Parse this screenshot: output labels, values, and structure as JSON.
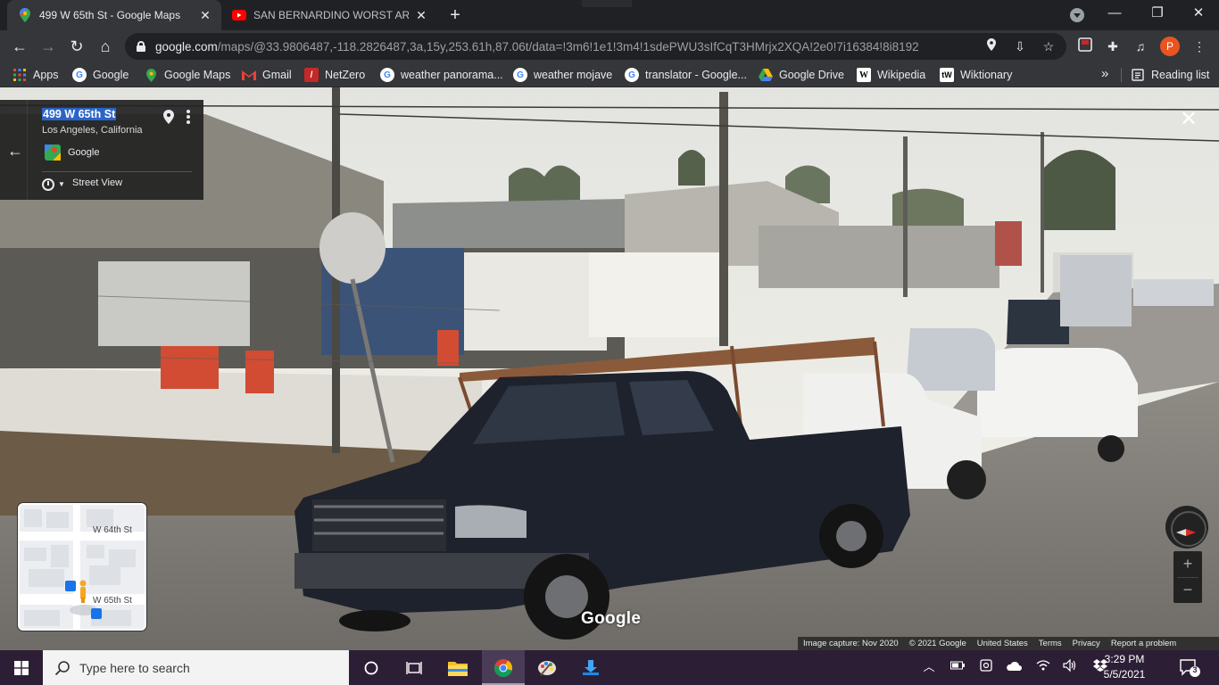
{
  "browser": {
    "tabs": [
      {
        "title": "499 W 65th St - Google Maps",
        "icon": "google-maps-icon",
        "active": true
      },
      {
        "title": "SAN BERNARDINO WORST AREA",
        "icon": "youtube-icon",
        "active": false
      }
    ],
    "url_host": "google.com",
    "url_path": "/maps/@33.9806487,-118.2826487,3a,15y,253.61h,87.06t/data=!3m6!1e1!3m4!1sdePWU3sIfCqT3HMrjx2XQA!2e0!7i16384!8i8192",
    "profile_initial": "P",
    "bookmarks": [
      {
        "label": "Apps",
        "icon": "apps-grid-icon"
      },
      {
        "label": "Google",
        "icon": "google-icon"
      },
      {
        "label": "Google Maps",
        "icon": "google-maps-icon"
      },
      {
        "label": "Gmail",
        "icon": "gmail-icon"
      },
      {
        "label": "NetZero",
        "icon": "netzero-icon"
      },
      {
        "label": "weather panorama...",
        "icon": "google-icon"
      },
      {
        "label": "weather mojave",
        "icon": "google-icon"
      },
      {
        "label": "translator - Google...",
        "icon": "google-icon"
      },
      {
        "label": "Google Drive",
        "icon": "google-drive-icon"
      },
      {
        "label": "Wikipedia",
        "icon": "wikipedia-icon"
      },
      {
        "label": "Wiktionary",
        "icon": "wiktionary-icon"
      }
    ],
    "more_bookmarks": "»",
    "reading_list": "Reading list"
  },
  "streetview": {
    "address_line1": "499 W 65th St",
    "address_line2": "Los Angeles, California",
    "source": "Google",
    "mode": "Street View",
    "watermark": "Google",
    "minimap": {
      "street_top": "W 64th St",
      "street_bottom": "W 65th St"
    },
    "zoom_in": "+",
    "zoom_out": "−",
    "attribution": {
      "capture": "Image capture: Nov 2020",
      "copyright": "© 2021 Google",
      "country": "United States",
      "terms": "Terms",
      "privacy": "Privacy",
      "report": "Report a problem"
    }
  },
  "taskbar": {
    "search_placeholder": "Type here to search",
    "time": "3:29 PM",
    "date": "5/5/2021",
    "notifications": "3"
  },
  "colors": {
    "chrome_dark": "#202124",
    "chrome_toolbar": "#35363a",
    "taskbar": "#2c1f35",
    "address_highlight": "#2a64c8"
  }
}
